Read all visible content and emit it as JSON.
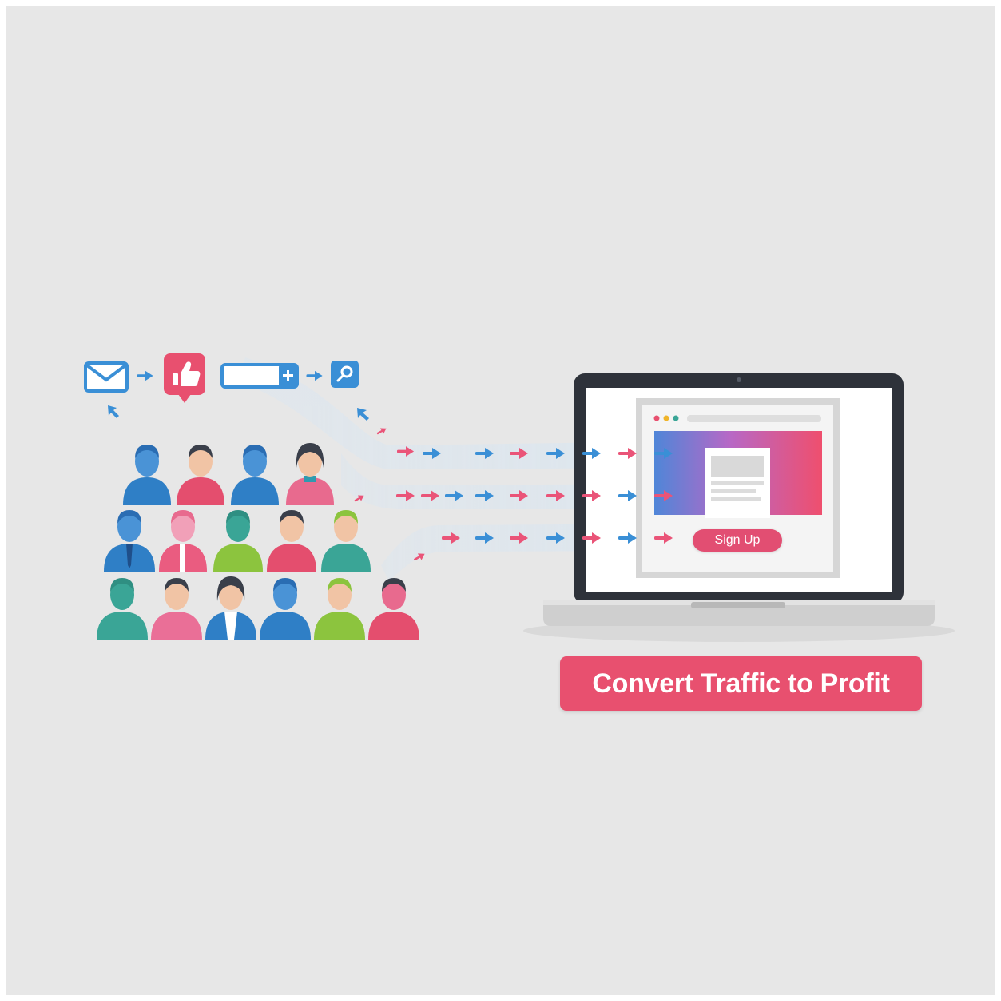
{
  "landing_page": {
    "cta_button_label": "Sign Up"
  },
  "banner": {
    "text": "Convert Traffic to Profit"
  },
  "channels": [
    "mail-icon",
    "thumbs-up-icon",
    "search-bar-plus-icon",
    "search-icon"
  ],
  "colors": {
    "background": "#e7e7e7",
    "accent_pink": "#e8506f",
    "accent_blue": "#3a8fd6",
    "green": "#8cc43e",
    "teal": "#3aa596"
  }
}
